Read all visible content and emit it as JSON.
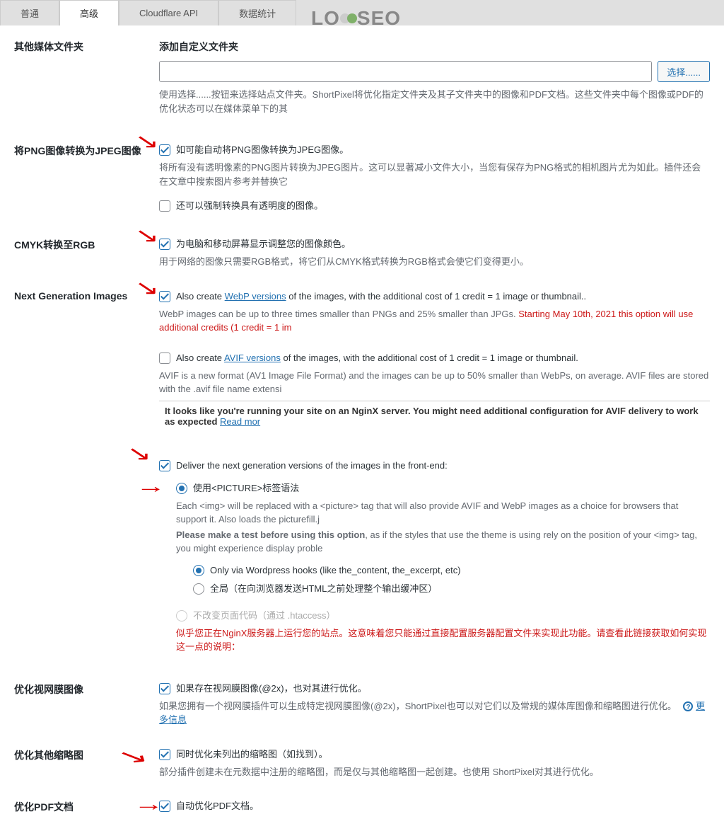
{
  "watermark": "LOYSEO",
  "tabs": {
    "normal": "普通",
    "advanced": "高级",
    "cloudflare": "Cloudflare API",
    "stats": "数据统计"
  },
  "mediaFolder": {
    "label": "其他媒体文件夹",
    "title": "添加自定义文件夹",
    "browseBtn": "选择......",
    "desc": "使用选择......按钮来选择站点文件夹。ShortPixel将优化指定文件夹及其子文件夹中的图像和PDF文档。这些文件夹中每个图像或PDF的优化状态可以在媒体菜单下的其"
  },
  "pngToJpeg": {
    "label": "将PNG图像转换为JPEG图像",
    "chk1": "如可能自动将PNG图像转换为JPEG图像。",
    "desc1": "将所有没有透明像素的PNG图片转换为JPEG图片。这可以显著减小文件大小，当您有保存为PNG格式的相机图片尤为如此。插件还会在文章中搜索图片参考并替换它",
    "chk2": "还可以强制转换具有透明度的图像。"
  },
  "cmykRgb": {
    "label": "CMYK转换至RGB",
    "chk1": "为电脑和移动屏幕显示调整您的图像颜色。",
    "desc1": "用于网络的图像只需要RGB格式，将它们从CMYK格式转换为RGB格式会使它们变得更小。"
  },
  "nextGen": {
    "label": "Next Generation Images",
    "webp_pre": "Also create ",
    "webp_link": "WebP versions",
    "webp_post": " of the images, with the additional cost of 1 credit = 1 image or thumbnail..",
    "webp_desc_pre": "WebP images can be up to three times smaller than PNGs and 25% smaller than JPGs. ",
    "webp_desc_warn": "Starting May 10th, 2021 this option will use additional credits (1 credit = 1 im",
    "avif_pre": "Also create ",
    "avif_link": "AVIF versions",
    "avif_post": " of the images, with the additional cost of 1 credit = 1 image or thumbnail.",
    "avif_desc": "AVIF is a new format (AV1 Image File Format) and the images can be up to 50% smaller than WebPs, on average. AVIF files are stored with the .avif file name extensi",
    "avif_box": "It looks like you're running your site on an NginX server. You might need additional configuration for AVIF delivery to work as expected ",
    "avif_box_link": "Read mor",
    "deliver": "Deliver the next generation versions of the images in the front-end:",
    "picture": "使用<PICTURE>标签语法",
    "picture_desc1": "Each <img> will be replaced with a <picture> tag that will also provide AVIF and WebP images as a choice for browsers that support it. Also loads the picturefill.j",
    "picture_desc2_bold": "Please make a test before using this option",
    "picture_desc2": ", as if the styles that use the theme is using rely on the position of your <img> tag, you might experience display proble",
    "hooks": "Only via Wordpress hooks (like the_content, the_excerpt, etc)",
    "global": "全局（在向浏览器发送HTML之前处理整个输出缓冲区）",
    "htaccess": "不改变页面代码（通过 .htaccess）",
    "htaccess_warn": "似乎您正在NginX服务器上运行您的站点。这意味着您只能通过直接配置服务器配置文件来实现此功能。请查看此链接获取如何实现这一点的说明："
  },
  "retina": {
    "label": "优化视网膜图像",
    "chk": "如果存在视网膜图像(@2x)，也对其进行优化。",
    "desc": "如果您拥有一个视网膜插件可以生成特定视网膜图像(@2x)，ShortPixel也可以对它们以及常规的媒体库图像和缩略图进行优化。",
    "more": "更多信息"
  },
  "otherThumbs": {
    "label": "优化其他缩略图",
    "chk": "同时优化未列出的缩略图（如找到）。",
    "desc": "部分插件创建未在元数据中注册的缩略图，而是仅与其他缩略图一起创建。也使用 ShortPixel对其进行优化。"
  },
  "pdf": {
    "label": "优化PDF文档",
    "chk": "自动优化PDF文档。"
  }
}
